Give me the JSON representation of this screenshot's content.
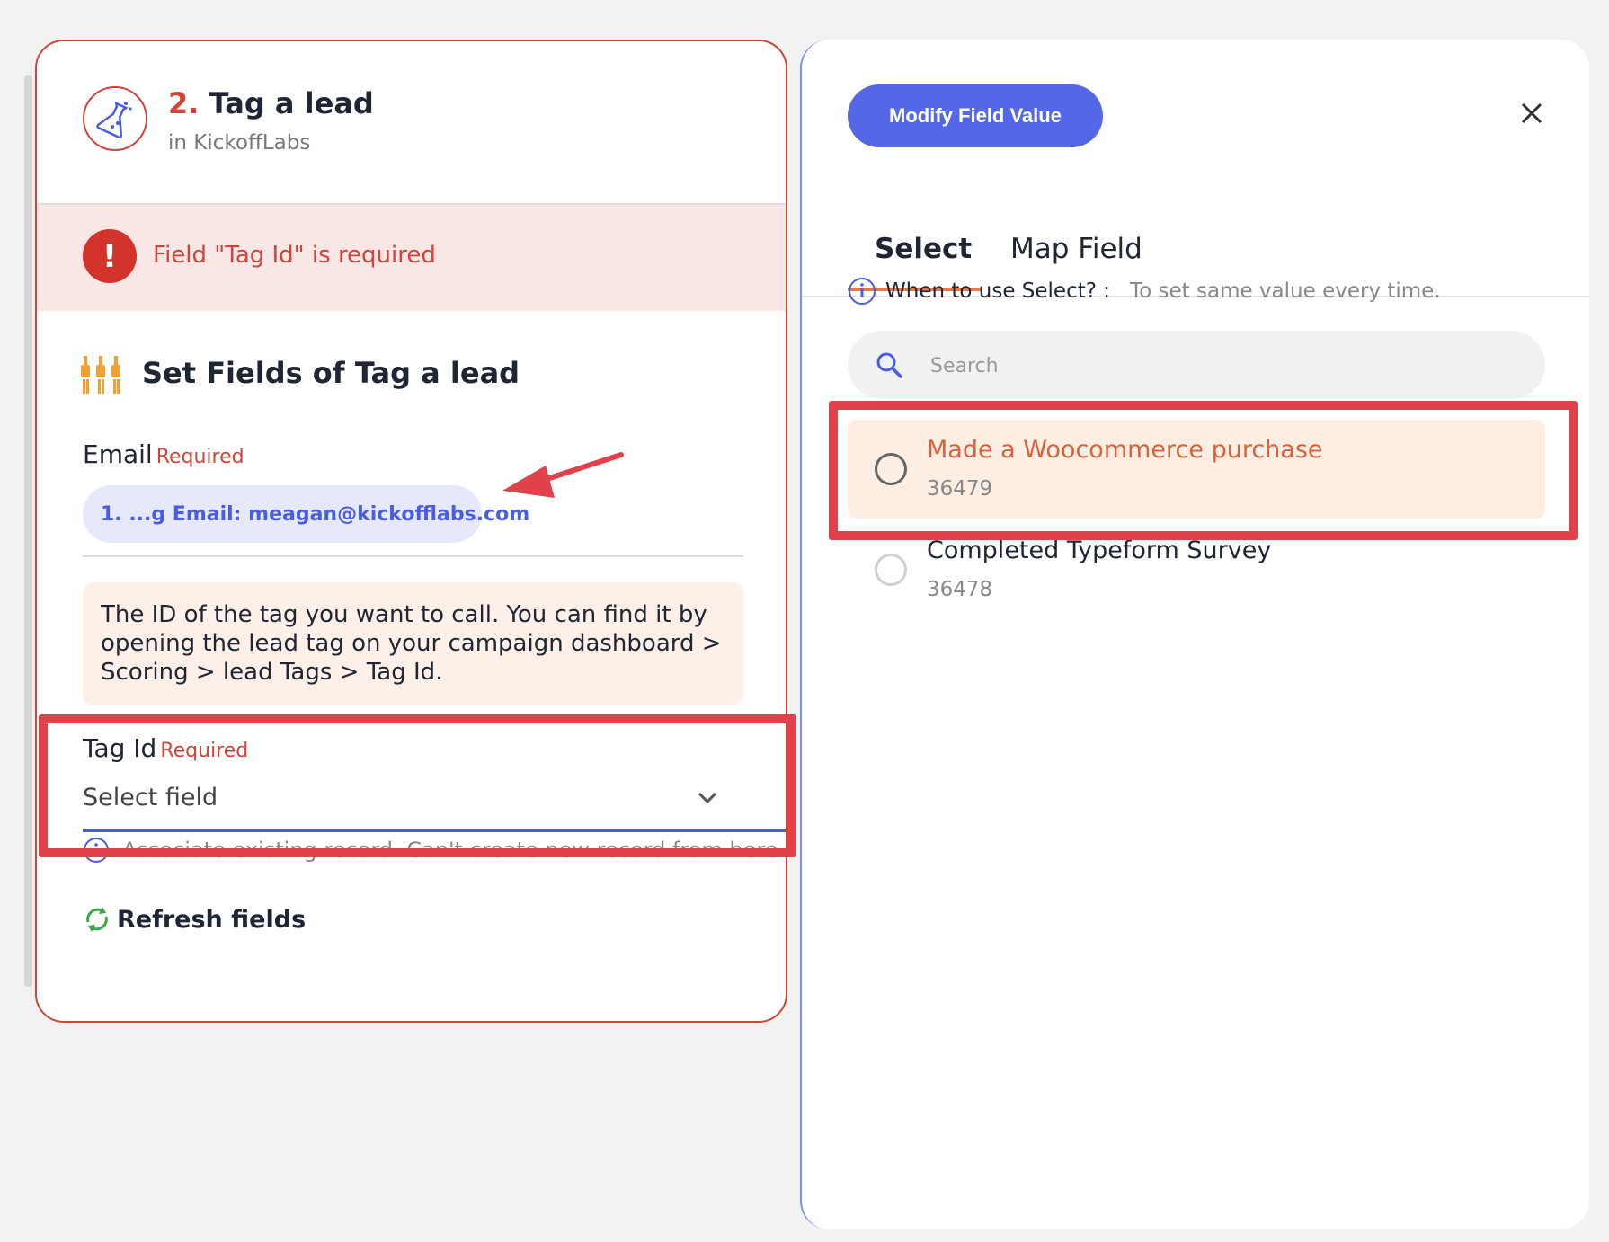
{
  "step": {
    "number": "2.",
    "title": "Tag a lead",
    "app": "in KickoffLabs"
  },
  "error": {
    "message": "Field \"Tag Id\" is required"
  },
  "fields_section": {
    "title": "Set Fields of Tag a lead"
  },
  "email_field": {
    "label": "Email",
    "required": "Required",
    "value": "1. ...g Email: meagan@kickofflabs.com"
  },
  "hint": "The ID of the tag you want to call. You can find it by opening the lead tag on your campaign dashboard > Scoring > lead Tags > Tag Id.",
  "tag_id_field": {
    "label": "Tag Id",
    "required": "Required",
    "placeholder": "Select field"
  },
  "associate_note": "Associate existing record. Can't create new record from here.",
  "refresh_label": "Refresh fields",
  "side_panel": {
    "modify_button": "Modify Field Value",
    "tabs": [
      {
        "label": "Select",
        "active": true
      },
      {
        "label": "Map Field",
        "active": false
      }
    ],
    "when_label": "When to use Select? :",
    "when_value": "To set same value every time.",
    "search_placeholder": "Search",
    "options": [
      {
        "title": "Made a Woocommerce purchase",
        "id": "36479",
        "highlighted": true
      },
      {
        "title": "Completed Typeform Survey",
        "id": "36478",
        "highlighted": false
      }
    ]
  },
  "colors": {
    "brand_red": "#d2443a",
    "accent_blue": "#5468e7",
    "highlight_red": "#e0414a",
    "option_orange": "#d9623a"
  }
}
